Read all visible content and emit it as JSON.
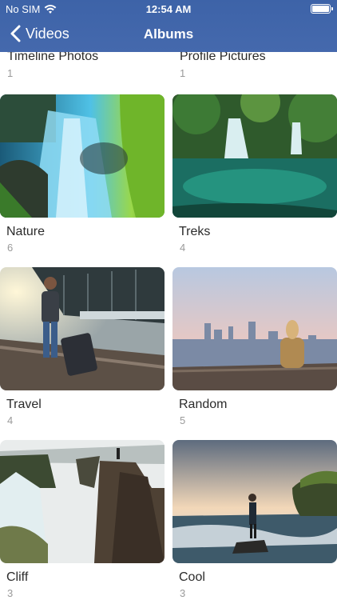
{
  "status_bar": {
    "carrier": "No SIM",
    "time": "12:54 AM"
  },
  "nav": {
    "back_label": "Videos",
    "title": "Albums"
  },
  "albums_top": [
    {
      "title": "Timeline Photos",
      "count": "1"
    },
    {
      "title": "Profile Pictures",
      "count": "1"
    }
  ],
  "albums": [
    {
      "title": "Nature",
      "count": "6"
    },
    {
      "title": "Treks",
      "count": "4"
    },
    {
      "title": "Travel",
      "count": "4"
    },
    {
      "title": "Random",
      "count": "5"
    },
    {
      "title": "Cliff",
      "count": "3"
    },
    {
      "title": "Cool",
      "count": "3"
    }
  ],
  "colors": {
    "nav_bar": "#4569ad",
    "title_text": "#2b2b2b",
    "count_text": "#9a9a9a"
  },
  "icons": {
    "back": "chevron-left-icon",
    "wifi": "wifi-icon",
    "battery": "battery-icon"
  }
}
